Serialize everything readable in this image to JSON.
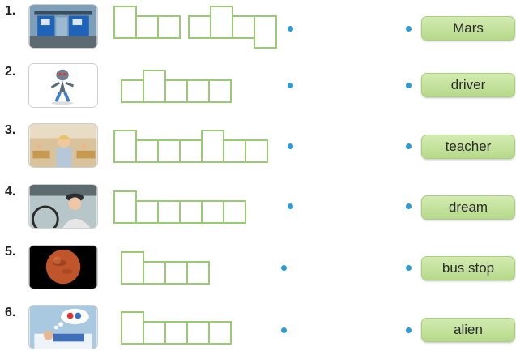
{
  "items": [
    {
      "number": "1.",
      "image": "bus-stop-photo",
      "word": "Mars"
    },
    {
      "number": "2.",
      "image": "alien-figure",
      "word": "driver"
    },
    {
      "number": "3.",
      "image": "teacher-classroom-photo",
      "word": "teacher"
    },
    {
      "number": "4.",
      "image": "bus-driver-photo",
      "word": "dream"
    },
    {
      "number": "5.",
      "image": "planet-mars-photo",
      "word": "bus stop"
    },
    {
      "number": "6.",
      "image": "dreaming-child-photo",
      "word": "alien"
    }
  ],
  "colors": {
    "box_border": "#9acb74",
    "dot": "#2d9bd6",
    "word_bg": "#c6e3a0"
  }
}
